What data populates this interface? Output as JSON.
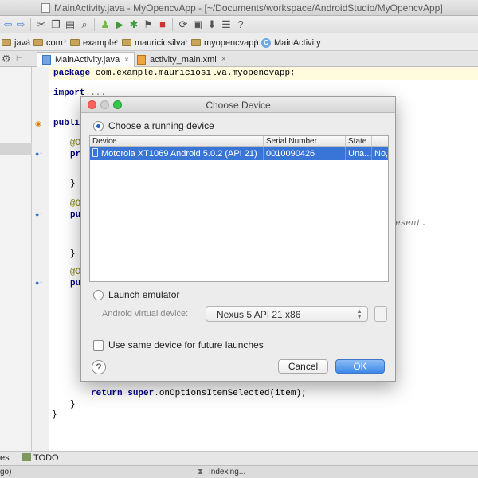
{
  "window": {
    "title": "MainActivity.java - MyOpencvApp - [~/Documents/workspace/AndroidStudio/MyOpencvApp]"
  },
  "breadcrumb": [
    "java",
    "com",
    "example",
    "mauriciosilva",
    "myopencvapp",
    "MainActivity"
  ],
  "tabs": [
    {
      "label": "MainActivity.java",
      "close": "×"
    },
    {
      "label": "activity_main.xml",
      "close": "×"
    }
  ],
  "editor": {
    "line_package_kw": "package",
    "line_package_rest": " com.example.mauriciosilva.myopencvapp;",
    "line_import_kw": "import",
    "line_import_rest": " ...",
    "line_public": "public",
    "ann1": "@O",
    "pr1": "pr",
    "brace1": "}",
    "ann2": "@O",
    "pu2": "pu",
    "brace2": "}",
    "ann3": "@O",
    "pu3": "pu",
    "hint_present": "esent.",
    "return_kw": "return",
    "super_kw": "super",
    "return_rest": ".onOptionsItemSelected(item);",
    "close_inner": "}",
    "close_outer": "}"
  },
  "bottom": {
    "left_fragment": "es",
    "todo": "TODO"
  },
  "status": {
    "left_fragment": "go)",
    "indexing": "Indexing..."
  },
  "dialog": {
    "title": "Choose Device",
    "running_label": "Choose a running device",
    "columns": [
      "Device",
      "Serial Number",
      "State",
      "..."
    ],
    "rows": [
      {
        "device": "Motorola XT1069 Android 5.0.2 (API 21)",
        "serial": "0010090426",
        "state": "Una...",
        "extra": "No,"
      }
    ],
    "emulator_label": "Launch emulator",
    "avd_label": "Android virtual device:",
    "avd_value": "Nexus 5 API 21 x86",
    "browse_label": "...",
    "same_device_label": "Use same device for future launches",
    "help": "?",
    "cancel": "Cancel",
    "ok": "OK"
  },
  "colors": {
    "accent": "#3875d7",
    "ok_button": "#3c88e8",
    "keyword": "#000080",
    "annotation": "#808000"
  }
}
